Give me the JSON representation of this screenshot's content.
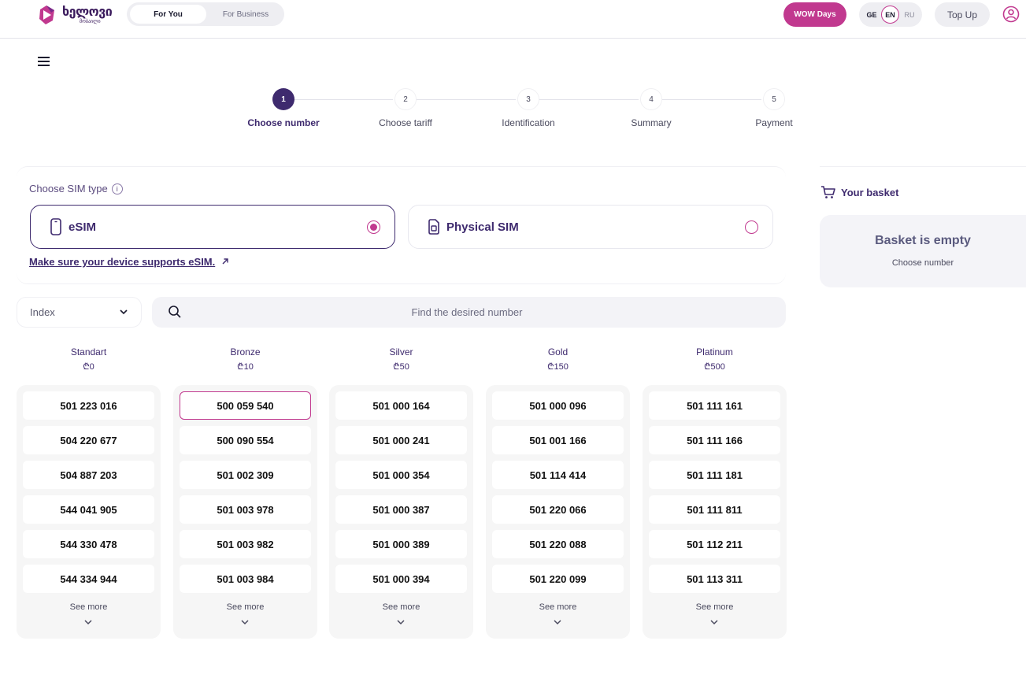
{
  "header": {
    "logo_text": "ხელოვი",
    "logo_sub": "მობაილი",
    "segments": [
      "For You",
      "For Business"
    ],
    "wow_label": "WOW Days",
    "languages": [
      "GE",
      "EN",
      "RU"
    ],
    "topup_label": "Top Up"
  },
  "stepper": [
    {
      "num": "1",
      "label": "Choose number"
    },
    {
      "num": "2",
      "label": "Choose tariff"
    },
    {
      "num": "3",
      "label": "Identification"
    },
    {
      "num": "4",
      "label": "Summary"
    },
    {
      "num": "5",
      "label": "Payment"
    }
  ],
  "sim": {
    "title": "Choose SIM type",
    "info": "i",
    "options": [
      "eSIM",
      "Physical SIM"
    ],
    "link": "Make sure your device supports eSIM."
  },
  "filters": {
    "index_label": "Index",
    "search_placeholder": "Find the desired number"
  },
  "columns": [
    {
      "title": "Standart",
      "price": "₾0",
      "numbers": [
        "501 223 016",
        "504 220 677",
        "504 887 203",
        "544 041 905",
        "544 330 478",
        "544 334 944"
      ],
      "more": "See more"
    },
    {
      "title": "Bronze",
      "price": "₾10",
      "numbers": [
        "500 059 540",
        "500 090 554",
        "501 002 309",
        "501 003 978",
        "501 003 982",
        "501 003 984"
      ],
      "more": "See more"
    },
    {
      "title": "Silver",
      "price": "₾50",
      "numbers": [
        "501 000 164",
        "501 000 241",
        "501 000 354",
        "501 000 387",
        "501 000 389",
        "501 000 394"
      ],
      "more": "See more"
    },
    {
      "title": "Gold",
      "price": "₾150",
      "numbers": [
        "501 000 096",
        "501 001 166",
        "501 114 414",
        "501 220 066",
        "501 220 088",
        "501 220 099"
      ],
      "more": "See more"
    },
    {
      "title": "Platinum",
      "price": "₾500",
      "numbers": [
        "501 111 161",
        "501 111 166",
        "501 111 181",
        "501 111 811",
        "501 112 211",
        "501 113 311"
      ],
      "more": "See more"
    }
  ],
  "basket": {
    "title": "Your basket",
    "empty": "Basket is empty",
    "sub": "Choose number"
  },
  "colors": {
    "accent": "#c1398f",
    "primary": "#3e2a6e"
  }
}
